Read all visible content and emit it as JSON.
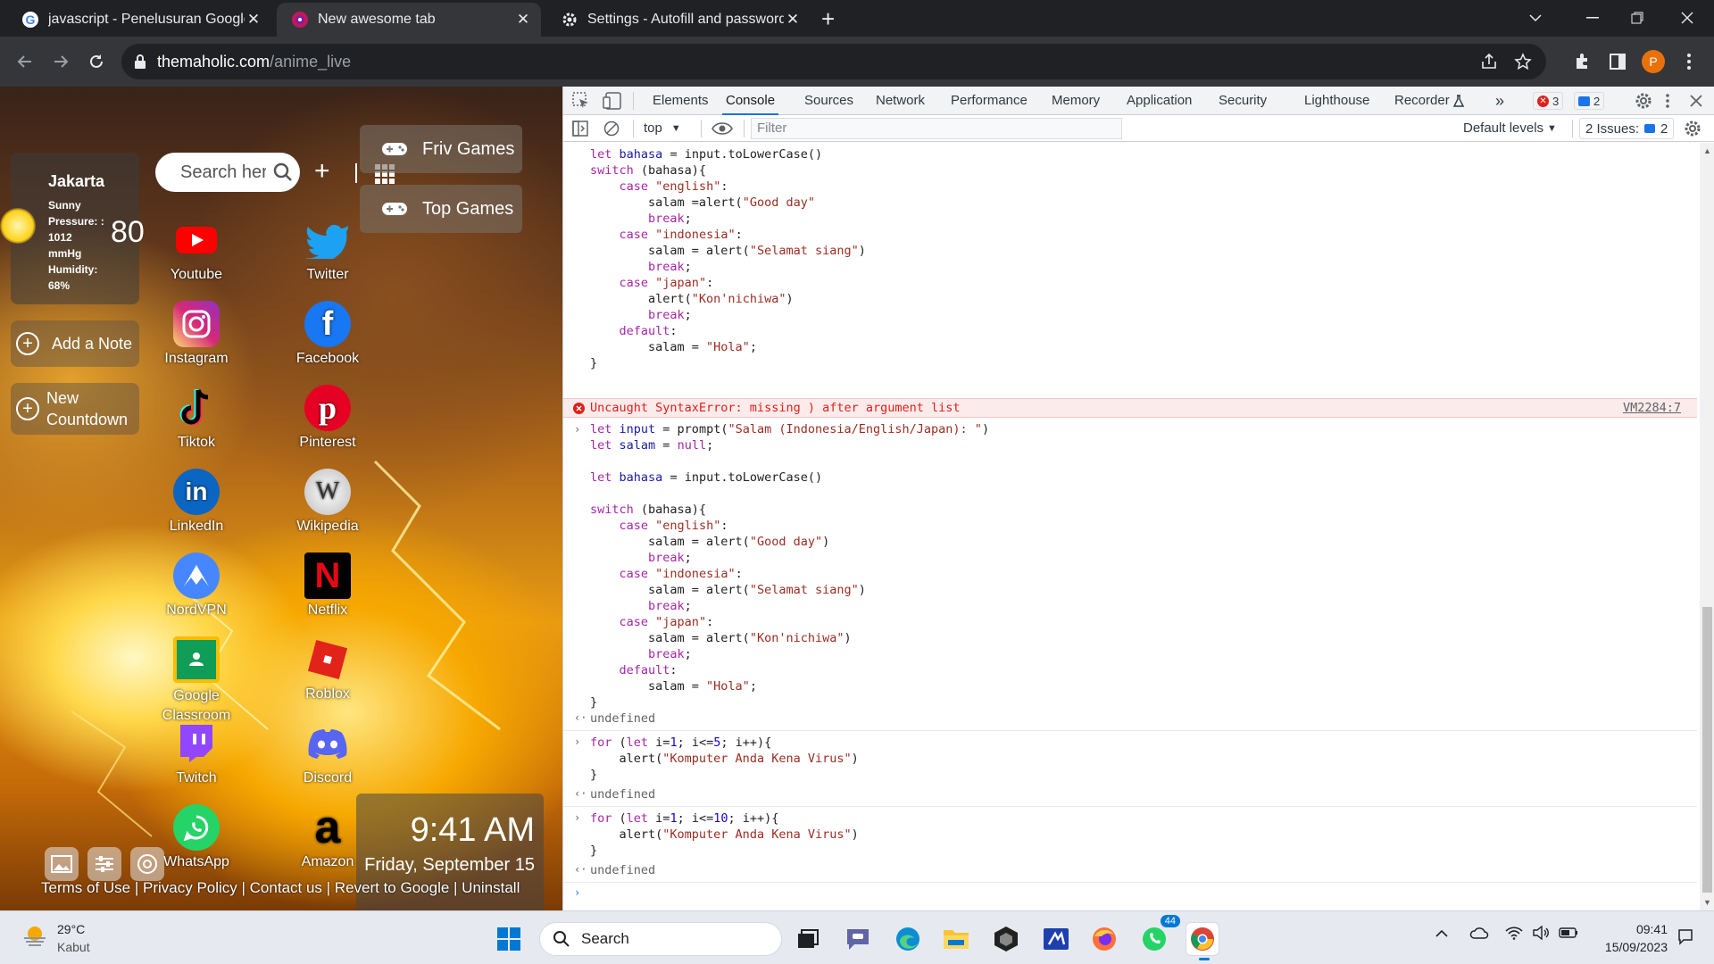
{
  "browser": {
    "tabs": [
      {
        "title": "javascript - Penelusuran Google"
      },
      {
        "title": "New awesome tab"
      },
      {
        "title": "Settings - Autofill and passwords"
      }
    ],
    "url_host": "themaholic.com",
    "url_path": "/anime_live",
    "profile_letter": "P"
  },
  "newtab": {
    "weather": {
      "city": "Jakarta",
      "condition": "Sunny",
      "pressure_label": "Pressure: :",
      "pressure_value": "1012",
      "pressure_unit": "mmHg",
      "humidity_label": "Humidity:",
      "humidity_value": "68%",
      "temp": "80"
    },
    "search_placeholder": "Search here",
    "game_buttons": [
      "Friv Games",
      "Top Games"
    ],
    "side_buttons": {
      "note": "Add a Note",
      "countdown_1": "New",
      "countdown_2": "Countdown"
    },
    "apps": [
      {
        "name": "Youtube",
        "icon": "youtube-icon"
      },
      {
        "name": "Twitter",
        "icon": "twitter-icon"
      },
      {
        "name": "Instagram",
        "icon": "instagram-icon"
      },
      {
        "name": "Facebook",
        "icon": "facebook-icon"
      },
      {
        "name": "Tiktok",
        "icon": "tiktok-icon"
      },
      {
        "name": "Pinterest",
        "icon": "pinterest-icon"
      },
      {
        "name": "LinkedIn",
        "icon": "linkedin-icon"
      },
      {
        "name": "Wikipedia",
        "icon": "wikipedia-icon"
      },
      {
        "name": "NordVPN",
        "icon": "nordvpn-icon"
      },
      {
        "name": "Netflix",
        "icon": "netflix-icon"
      },
      {
        "name": "Google Classroom",
        "icon": "classroom-icon"
      },
      {
        "name": "Roblox",
        "icon": "roblox-icon"
      },
      {
        "name": "Twitch",
        "icon": "twitch-icon"
      },
      {
        "name": "Discord",
        "icon": "discord-icon"
      },
      {
        "name": "WhatsApp",
        "icon": "whatsapp-icon"
      },
      {
        "name": "Amazon",
        "icon": "amazon-icon"
      }
    ],
    "clock": {
      "time": "9:41 AM",
      "date": "Friday, September 15"
    },
    "footer": "Terms of Use | Privacy Policy | Contact us | Revert to Google | Uninstall"
  },
  "devtools": {
    "tabs": [
      "Elements",
      "Console",
      "Sources",
      "Network",
      "Performance",
      "Memory",
      "Application",
      "Security",
      "Lighthouse",
      "Recorder"
    ],
    "active_tab": "Console",
    "error_count": "3",
    "message_count": "2",
    "context": "top",
    "filter_placeholder": "Filter",
    "levels": "Default levels",
    "issues_label": "2 Issues:",
    "issues_count": "2",
    "error_text": "Uncaught SyntaxError: missing ) after argument list",
    "error_link": "VM2284:7",
    "undefined": "undefined"
  },
  "taskbar": {
    "temp": "29°C",
    "condition": "Kabut",
    "search": "Search",
    "time": "09:41",
    "date": "15/09/2023",
    "whatsapp_badge": "44"
  }
}
